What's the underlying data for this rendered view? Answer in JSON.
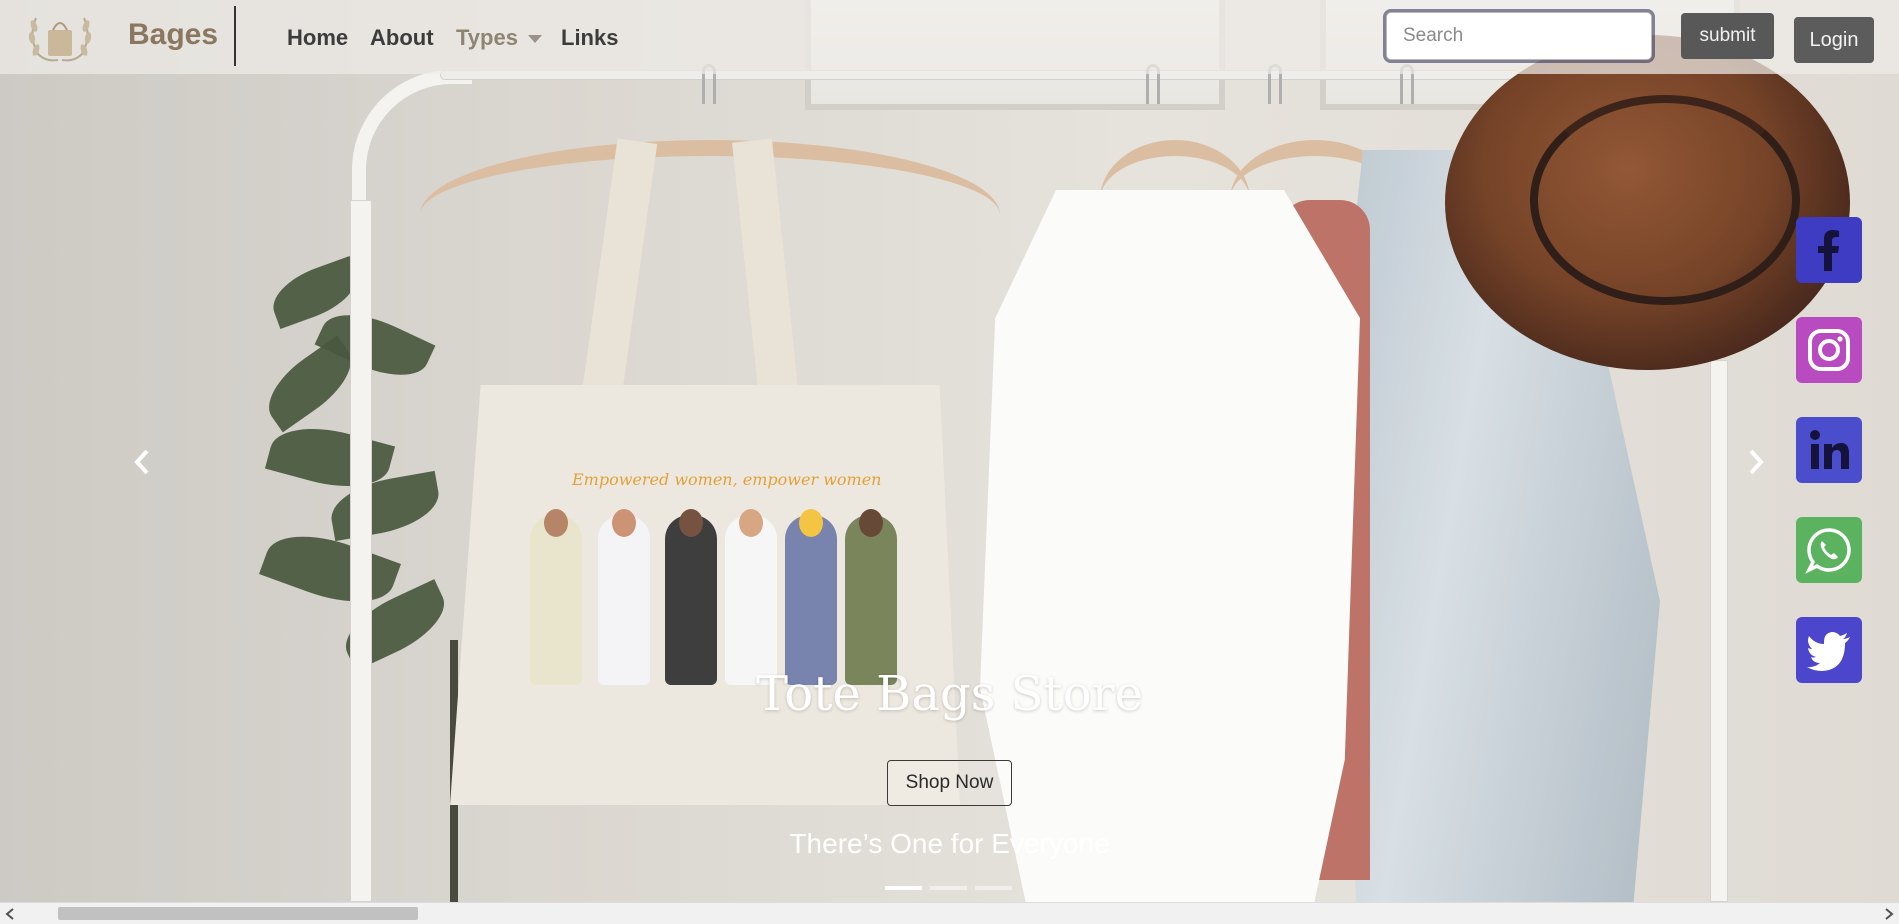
{
  "navbar": {
    "brand": "Bages",
    "links": [
      {
        "label": "Home"
      },
      {
        "label": "About"
      },
      {
        "label": "Types"
      },
      {
        "label": "Links"
      }
    ],
    "search_placeholder": "Search",
    "submit_label": "submit",
    "login_label": "Login"
  },
  "hero": {
    "tote_slogan": "Empowered women, empower women",
    "title": "Tote Bags Store",
    "button_label": "Shop Now",
    "subtitle": "There’s One for Everyone",
    "slides": 3,
    "active_slide": 1,
    "prev_icon": "chevron-left-icon",
    "next_icon": "chevron-right-icon"
  },
  "social": [
    {
      "name": "facebook",
      "icon": "facebook-icon",
      "color": "#3f3cc4"
    },
    {
      "name": "instagram",
      "icon": "instagram-icon",
      "color": "#b74bbf"
    },
    {
      "name": "linkedin",
      "icon": "linkedin-icon",
      "color": "#4a4dcc"
    },
    {
      "name": "whatsapp",
      "icon": "whatsapp-icon",
      "color": "#5bb25f"
    },
    {
      "name": "twitter",
      "icon": "twitter-icon",
      "color": "#4b46cc"
    }
  ],
  "colors": {
    "brand": "#8a7760",
    "nav_text": "#3c3c3c",
    "button_dark": "#585858"
  }
}
